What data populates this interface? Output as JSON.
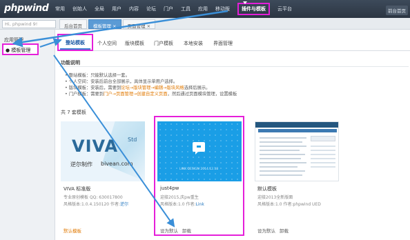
{
  "header": {
    "logo": "phpwind",
    "nav": [
      "常用",
      "创始人",
      "全局",
      "用户",
      "内容",
      "论坛",
      "门户",
      "工具",
      "应用",
      "移动版",
      "插件与模板",
      "云平台"
    ],
    "nav_highlight": "插件与模板",
    "right_button": "前台首页"
  },
  "subbar": {
    "search_placeholder": "Hi,  phpwind 9!",
    "tabs": [
      "后台首页",
      "模板管理 ×",
      "页面管理 ×"
    ]
  },
  "sidebar": {
    "items": [
      "应用管理",
      "模板管理"
    ]
  },
  "main_tabs": [
    "整站模板",
    "个人空间",
    "版块模板",
    "门户模板",
    "本地安装",
    "界面管理"
  ],
  "section": {
    "title": "功能说明",
    "notes": [
      {
        "pre": "整站模板：只能默认选择一套。",
        "mid": "",
        "post": ""
      },
      {
        "pre": "个人空间：安装后前台全部展示，具体显示单用户选择。",
        "mid": "",
        "post": ""
      },
      {
        "pre": "版块模板：安装后，需要到",
        "mid": "论坛→版块管理→编辑→版块风格",
        "post": "选择后展示。"
      },
      {
        "pre": "门户模板：需要到",
        "mid": "门户→页面管理→创建自定义页面",
        "post": "，然后通过页面模块管理，设置模板"
      }
    ]
  },
  "count_label": "共 7 套模板",
  "templates": [
    {
      "name": "VIVA 标准版",
      "line1": "专业原创模板 QQ: 630017800",
      "version_label": "风格版本:1.0.4.150120",
      "author_label": "作者:",
      "author": "逆尔",
      "actions": [
        "默认模板"
      ],
      "thumb": {
        "word": "VIVA",
        "std": "Std",
        "sub": "逆尔制作",
        "url": "bivean.com"
      }
    },
    {
      "name": "just4pw",
      "line1": "迎接2015,庆pw重生",
      "version_label": "风格版本:1.0",
      "author_label": "作者:",
      "author": "Link",
      "actions": [
        "设为默认",
        "卸载"
      ],
      "thumb": {
        "caption": "LINK DESIGN 2014.12.18"
      }
    },
    {
      "name": "默认模板",
      "line1": "迎接2013全新版面",
      "version_label": "风格版本:1.0",
      "author_label": "作者:",
      "author": "phpwind UED",
      "actions": [
        "设为默认",
        "卸载"
      ]
    }
  ],
  "colors": {
    "accent_highlight": "#e51ed9",
    "arrow": "#3a8fd8",
    "topbar": "#2b3542",
    "just_blue": "#1a9ee6"
  }
}
